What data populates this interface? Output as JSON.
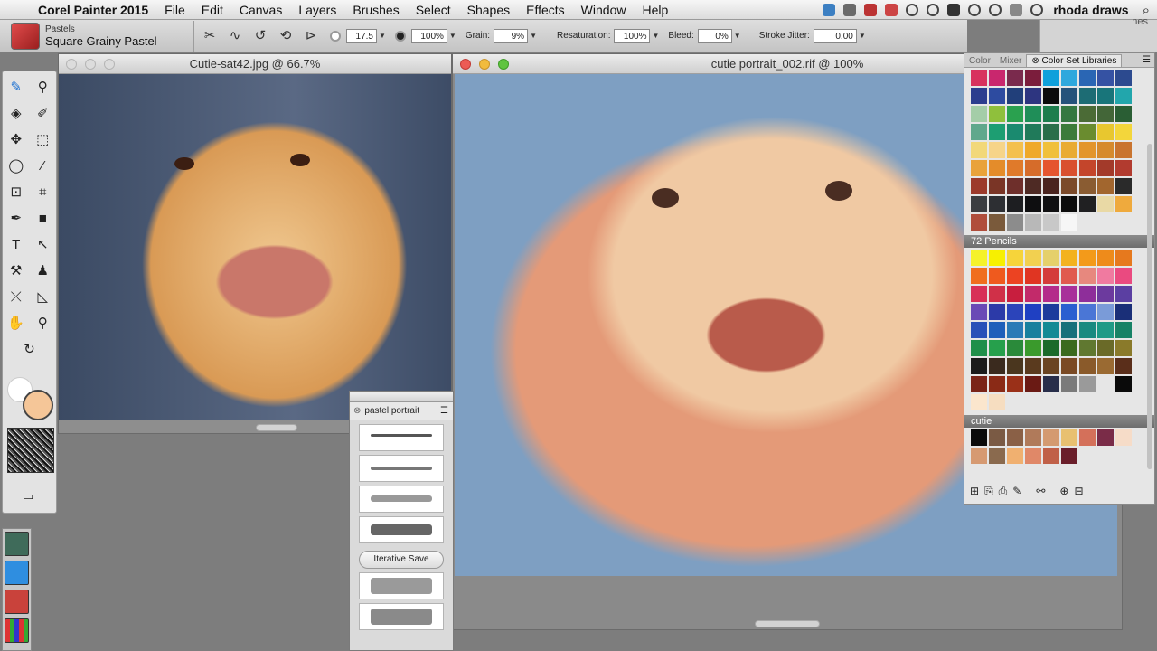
{
  "menubar": {
    "apple_glyph": "",
    "app_name": "Corel Painter 2015",
    "items": [
      "File",
      "Edit",
      "Canvas",
      "Layers",
      "Brushes",
      "Select",
      "Shapes",
      "Effects",
      "Window",
      "Help"
    ],
    "user": "rhoda draws",
    "search_glyph": "⌕"
  },
  "propbar": {
    "brush_category": "Pastels",
    "brush_variant": "Square Grainy Pastel",
    "size": "17.5",
    "opacity": "100%",
    "grain_label": "Grain:",
    "grain": "9%",
    "resaturation_label": "Resaturation:",
    "resaturation": "100%",
    "bleed_label": "Bleed:",
    "bleed": "0%",
    "jitter_label": "Stroke Jitter:",
    "jitter": "0.00"
  },
  "windows": {
    "reference_title": "Cutie-sat42.jpg @ 66.7%",
    "painting_title": "cutie portrait_002.rif @ 100%"
  },
  "brush_palette": {
    "tab_label": "pastel portrait",
    "iterative_save": "Iterative Save"
  },
  "color_panel": {
    "tabs": [
      "Color",
      "Mixer",
      "Color Set Libraries"
    ],
    "set1_colors": [
      "#d8325e",
      "#c9276e",
      "#7a2a4d",
      "#7b1d3c",
      "#0fa0db",
      "#2fa8dd",
      "#2a66b4",
      "#3552a3",
      "#2c4a8f",
      "#2c3d8e",
      "#2d4ba0",
      "#213f7a",
      "#2d3580",
      "#0b0b0b",
      "#25527a",
      "#1d6c74",
      "#18757a",
      "#22a6ac",
      "#a4cda8",
      "#8fc03c",
      "#2aa14f",
      "#1f8e58",
      "#1d7d4d",
      "#357841",
      "#4b6b36",
      "#436638",
      "#2a5e34",
      "#60a88c",
      "#1d9e72",
      "#1a8a6f",
      "#207a5a",
      "#2a6e4a",
      "#3c7b3a",
      "#6a8c2f",
      "#e8c72f",
      "#f3d63b",
      "#f2d87a",
      "#f6d488",
      "#f4c04e",
      "#efa92a",
      "#f0c03b",
      "#e9ab33",
      "#e3952c",
      "#d68a2d",
      "#c9742f",
      "#e9a23a",
      "#e48c2a",
      "#e07a2a",
      "#d66c2a",
      "#e5552f",
      "#d9502f",
      "#c4452b",
      "#a33a2a",
      "#b23b2f",
      "#9c3a2b",
      "#7a3526",
      "#6e2f2b",
      "#4e2a24",
      "#4a241f",
      "#7b4a2a",
      "#8a5c32",
      "#a2662e",
      "#2a2a2a",
      "#3b3d40",
      "#2d2f33",
      "#1d1e21",
      "#0e0e10",
      "#101012",
      "#0c0c0c",
      "#202022",
      "#e9d9a5",
      "#efaa3d",
      "#b04d3b",
      "#7a5a3b",
      "#8c8c8c",
      "#b8b8b8",
      "#c8c8c8",
      "#f6f6f6",
      "#e6e6e6",
      "#e6e6e6",
      "#e6e6e6"
    ],
    "set2_name": "72 Pencils",
    "set2_colors": [
      "#f5f22a",
      "#f7f000",
      "#f6d43a",
      "#f2d050",
      "#e5d06b",
      "#f3b21e",
      "#f39a1a",
      "#ee8b1b",
      "#e6791e",
      "#f06e1e",
      "#ef5a1e",
      "#ec4322",
      "#e03522",
      "#d43c3a",
      "#e05a4e",
      "#e7887e",
      "#f07aa0",
      "#ea4a80",
      "#d83058",
      "#d03048",
      "#c81e3e",
      "#c22a6a",
      "#b42c8a",
      "#a8309a",
      "#8e2e9a",
      "#6c3a9e",
      "#5b3fa2",
      "#6a4ab6",
      "#2c3aa8",
      "#2b44ba",
      "#1f40c2",
      "#1c3c9c",
      "#2a5fd0",
      "#4a76d6",
      "#7a9bd8",
      "#1a2f78",
      "#2850b8",
      "#1e5fba",
      "#2a7ab6",
      "#18809e",
      "#138a94",
      "#16707a",
      "#1a8a80",
      "#1e9a86",
      "#168266",
      "#1f8f4a",
      "#26a04c",
      "#2a8a3a",
      "#3a9a2c",
      "#1a6a2a",
      "#3a6a1e",
      "#607830",
      "#6a6a28",
      "#8a7a2a",
      "#1a1a1a",
      "#3a2a1e",
      "#4a361e",
      "#5a3a1e",
      "#6a4422",
      "#7a4a24",
      "#8a5a2a",
      "#9a6a32",
      "#5a2e1a",
      "#7a2418",
      "#8a2a16",
      "#9a3018",
      "#6a1a14",
      "#282e4a",
      "#7a7a7a",
      "#9a9a9a",
      "#e6e6e6",
      "#0a0a0a",
      "#fbe6cd",
      "#f6ddc0"
    ],
    "set3_name": "cutie",
    "set3_colors": [
      "#0a0a0a",
      "#7a5a44",
      "#8a6046",
      "#b07a5a",
      "#d49a70",
      "#e8c070",
      "#d4705a",
      "#7a2c48",
      "#f6dcc8",
      "#d69a72",
      "#8a6a4e",
      "#f0b070",
      "#e08868",
      "#c06048",
      "#6a1e2a"
    ],
    "footer_icons": [
      "new-set-icon",
      "open-set-icon",
      "save-set-icon",
      "edit-icon",
      "find-icon",
      "add-color-icon",
      "delete-color-icon"
    ]
  },
  "strip_text": "nes"
}
